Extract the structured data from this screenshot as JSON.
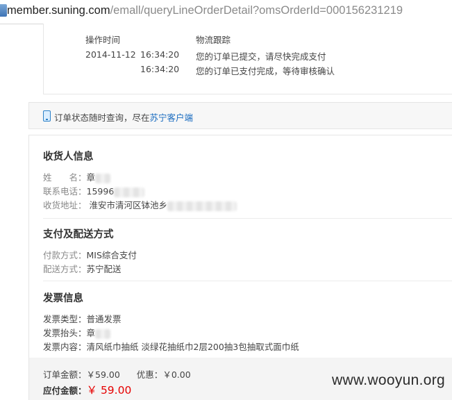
{
  "browser": {
    "url_domain": "member.suning.com",
    "url_path": "/emall/queryLineOrderDetail?omsOrderId=000156231219"
  },
  "tracking": {
    "col_time": "操作时间",
    "col_track": "物流跟踪",
    "entries": [
      {
        "date": "2014-11-12",
        "time": "16:34:20",
        "text": "您的订单已提交，请尽快完成支付"
      },
      {
        "date": "",
        "time": "16:34:20",
        "text": "您的订单已支付完成，等待审核确认"
      }
    ]
  },
  "tip": {
    "text": "订单状态随时查询，尽在",
    "link": "苏宁客户端"
  },
  "consignee": {
    "title": "收货人信息",
    "name_label": "姓　　名：",
    "name_value": "章",
    "phone_label": "联系电话：",
    "phone_value": "15996",
    "address_label": "收货地址：",
    "address_value": "淮安市清河区钵池乡"
  },
  "payment": {
    "title": "支付及配送方式",
    "method_label": "付款方式：",
    "method_value": "MIS综合支付",
    "delivery_label": "配送方式：",
    "delivery_value": "苏宁配送"
  },
  "invoice": {
    "title": "发票信息",
    "type_label": "发票类型：",
    "type_value": "普通发票",
    "header_label": "发票抬头：",
    "header_value": "章",
    "content_label": "发票内容：",
    "content_value": "清风纸巾抽纸 淡绿花抽纸巾2层200抽3包抽取式面巾纸"
  },
  "totals": {
    "order_label": "订单金额：",
    "order_value": "￥59.00",
    "discount_label": "优惠：",
    "discount_value": "￥0.00",
    "pay_label": "应付金额：",
    "pay_value": "￥ 59.00"
  },
  "watermark": "www.wooyun.org"
}
